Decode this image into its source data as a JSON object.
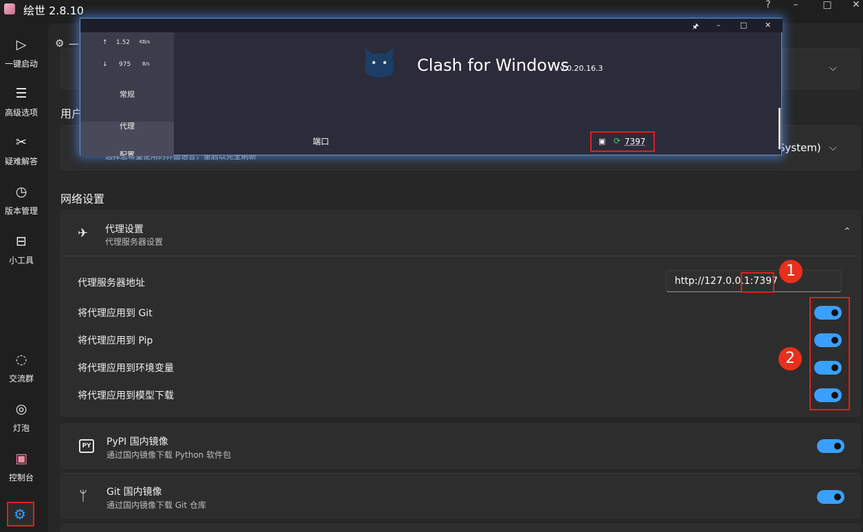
{
  "app": {
    "title": "绘世 2.8.10"
  },
  "window_controls": {
    "help": "?",
    "minimize": "–",
    "maximize": "□",
    "close": "✕"
  },
  "sidebar": {
    "items": [
      {
        "label": "一键启动",
        "icon": "▷"
      },
      {
        "label": "高级选项",
        "icon": "☰"
      },
      {
        "label": "疑难解答",
        "icon": "✂"
      },
      {
        "label": "版本管理",
        "icon": "◷"
      },
      {
        "label": "小工具",
        "icon": "⊟"
      },
      {
        "label": "交流群",
        "icon": "◌"
      },
      {
        "label": "灯泡",
        "icon": "◎"
      },
      {
        "label": "控制台",
        "icon": "▣"
      }
    ],
    "settings_icon": "⚙"
  },
  "main": {
    "breadcrumb_icon": "⚙",
    "breadcrumb": "一",
    "user_section_head": "用户",
    "language_hint": "选择您希望使用的界面语言，重启以完全刷新",
    "language_dropdown": "System)",
    "network_section_head": "网络设置",
    "proxy": {
      "title": "代理设置",
      "subtitle": "代理服务器设置",
      "address_label": "代理服务器地址",
      "address_value": "http://127.0.0.1:7397",
      "toggles": [
        {
          "label": "将代理应用到 Git",
          "on": true
        },
        {
          "label": "将代理应用到 Pip",
          "on": true
        },
        {
          "label": "将代理应用到环境变量",
          "on": true
        },
        {
          "label": "将代理应用到模型下载",
          "on": true
        }
      ]
    },
    "pypi": {
      "icon": "PY",
      "title": "PyPI 国内镜像",
      "subtitle": "通过国内镜像下载 Python 软件包",
      "on": true
    },
    "git": {
      "title": "Git 国内镜像",
      "subtitle": "通过国内镜像下载 Git 仓库",
      "on": true
    }
  },
  "annotations": {
    "badge1": "1",
    "badge2": "2"
  },
  "clash": {
    "title": "Clash for Windows",
    "version": "v 0.20.16.3",
    "upload_speed": "1.52",
    "upload_unit": "KB/s",
    "download_speed": "975",
    "download_unit": "B/s",
    "nav": [
      "常规",
      "代理",
      "配置"
    ],
    "port_label": "端口",
    "port_value": "7397",
    "controls": {
      "pin": "🖈",
      "minimize": "–",
      "maximize": "□",
      "close": "✕"
    }
  },
  "colors": {
    "accent": "#3aa0ff",
    "highlight_red": "#e02020",
    "badge_red": "#e8301c",
    "clash_glow": "#5f95d6"
  }
}
